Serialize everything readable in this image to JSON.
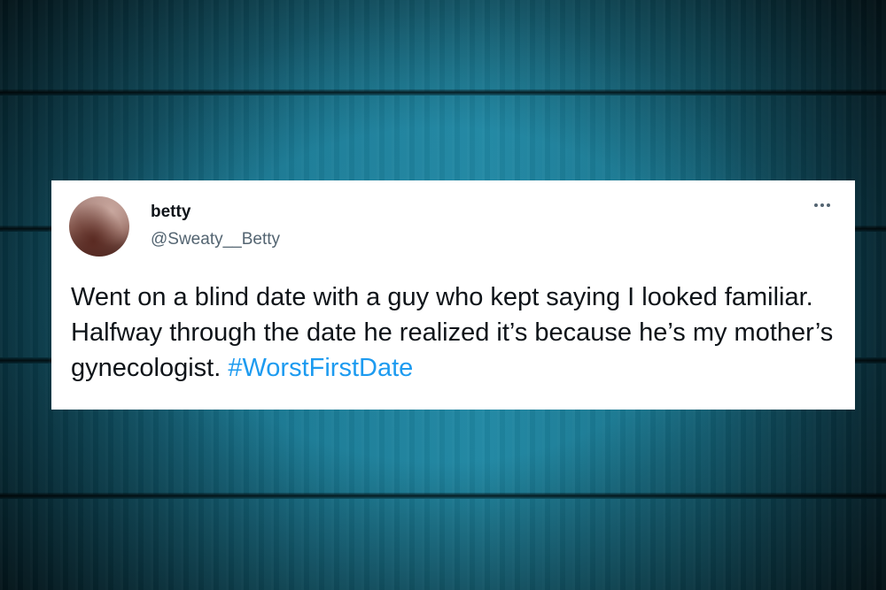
{
  "tweet": {
    "display_name": "betty",
    "handle": "@Sweaty__Betty",
    "text": "Went on a blind date with a guy who kept saying I looked familiar. Halfway through the date he realized it’s because he’s my mother’s gynecologist. ",
    "hashtag": "#WorstFirstDate",
    "more_icon": "more-horizontal-icon",
    "hashtag_color": "#1d9bf0"
  },
  "background": {
    "texture": "teal wood planks",
    "color": "#1a7a94"
  }
}
